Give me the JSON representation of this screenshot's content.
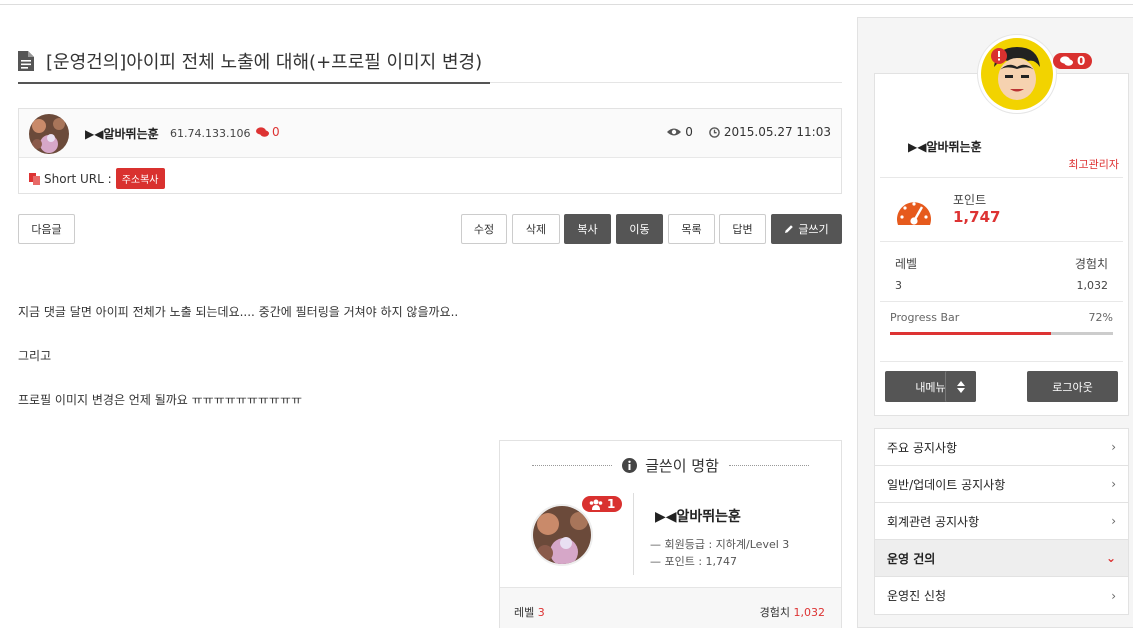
{
  "post": {
    "title": "[운영건의]아이피 전체 노출에 대해(+프로필 이미지 변경)",
    "author": "▶◀알바뛰는훈",
    "ip": "61.74.133.106",
    "comment_count": "0",
    "views": "0",
    "date": "2015.05.27 11:03",
    "short_url_label": "Short URL :",
    "copy_button": "주소복사"
  },
  "buttons": {
    "next": "다음글",
    "edit": "수정",
    "delete": "삭제",
    "copy": "복사",
    "move": "이동",
    "list": "목록",
    "reply": "답변",
    "write": "글쓰기"
  },
  "content": {
    "line1": "지금 댓글 달면 아이피 전체가 노출 되는데요.... 중간에 필터링을 거쳐야 하지 않을까요..",
    "line2": "그리고",
    "line3": "프로필 이미지 변경은 언제 될까요 ㅠㅠㅠㅠㅠㅠㅠㅠㅠㅠ"
  },
  "author_card": {
    "heading": "글쓴이 명함",
    "follower_count": "1",
    "name": "▶◀알바뛰는훈",
    "grade": "— 회원등급 : 지하계/Level 3",
    "points": "— 포인트 : 1,747",
    "level_label": "레벨",
    "level_value": "3",
    "exp_label": "경험치",
    "exp_value": "1,032"
  },
  "sidebar": {
    "notify_count": "0",
    "name": "▶◀알바뛰는훈",
    "role": "최고관리자",
    "point_label": "포인트",
    "point_value": "1,747",
    "level_label": "레벨",
    "level_value": "3",
    "exp_label": "경험치",
    "exp_value": "1,032",
    "progress_label": "Progress Bar",
    "progress_text": "72%",
    "progress_value": 0.72,
    "mymenu": "내메뉴",
    "logout": "로그아웃",
    "menu": [
      {
        "label": "주요 공지사항"
      },
      {
        "label": "일반/업데이트 공지사항"
      },
      {
        "label": "회계관련 공지사항"
      },
      {
        "label": "운영 건의"
      },
      {
        "label": "운영진 신청"
      }
    ]
  },
  "colors": {
    "accent": "#d9312f",
    "dark_button": "#555555"
  }
}
